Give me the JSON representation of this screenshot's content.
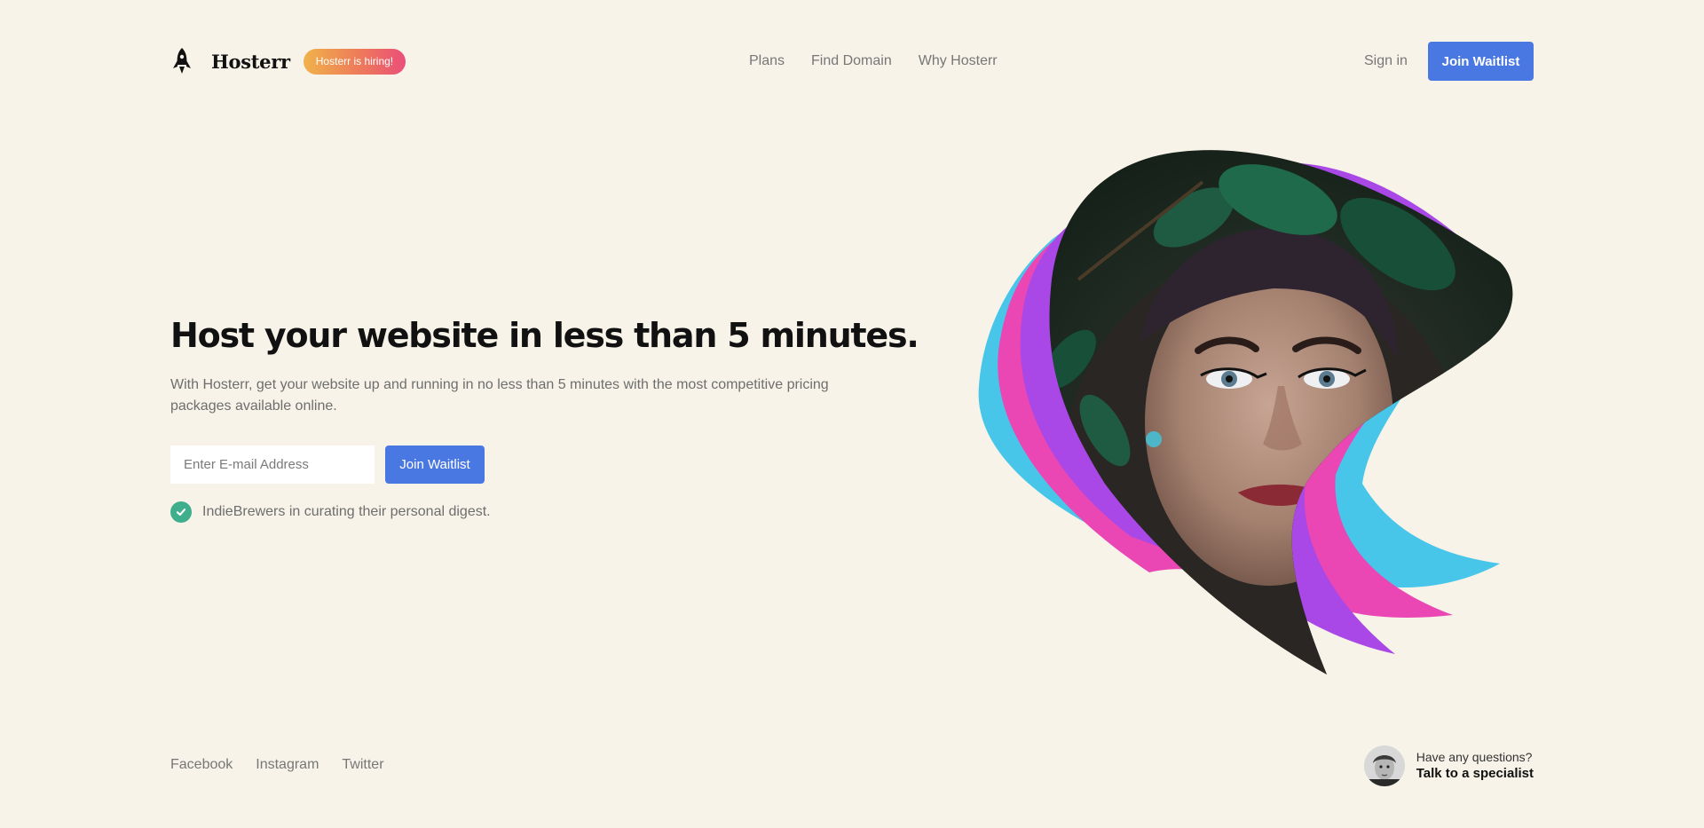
{
  "header": {
    "brand": "Hosterr",
    "hiring_badge": "Hosterr is hiring!",
    "nav": [
      {
        "label": "Plans",
        "icon": ""
      },
      {
        "label": "Find Domain"
      },
      {
        "label": "Why Hosterr"
      }
    ],
    "sign_in": "Sign in",
    "join_waitlist": "Join Waitlist"
  },
  "hero": {
    "title": "Host your website in less than 5 minutes.",
    "subtitle": "With Hosterr, get your website up and running in no less than 5 minutes with the most competitive pricing packages available online.",
    "email_placeholder": "Enter E-mail Address",
    "join_waitlist": "Join Waitlist",
    "check_text": "IndieBrewers in curating their personal digest."
  },
  "footer": {
    "social": [
      "Facebook",
      "Instagram",
      "Twitter"
    ],
    "contact_question": "Have any questions?",
    "contact_cta": "Talk to a specialist"
  },
  "icons": {
    "logo": "rocket-icon",
    "check": "check-circle-icon"
  },
  "colors": {
    "background": "#f7f3e8",
    "primary": "#4a78e3",
    "badge_start": "#f0b24a",
    "badge_end": "#ea4f79",
    "check": "#3fae8c",
    "wave_cyan": "#48c6ea",
    "wave_pink": "#ea47b4",
    "wave_purple": "#a948e6"
  }
}
